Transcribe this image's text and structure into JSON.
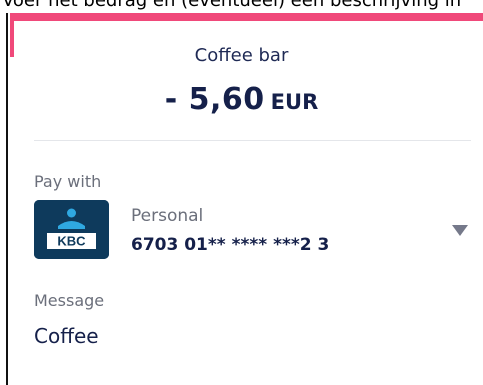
{
  "header": {
    "instruction_text": "Voer het bedrag en (eventueel) een beschrijving in"
  },
  "payment": {
    "payee": "Coffee bar",
    "amount": "- 5,60",
    "currency": "EUR"
  },
  "pay_with": {
    "label": "Pay with",
    "bank_logo_text": "KBC",
    "account_type": "Personal",
    "account_number": "6703 01** **** ***2 3",
    "dropdown_icon": "triangle-down-icon"
  },
  "message": {
    "label": "Message",
    "value": "Coffee"
  },
  "colors": {
    "accent_pink": "#f0497a",
    "navy_text": "#15204a",
    "gray_text": "#6b6f7b",
    "kbc_blue": "#0e3a5c",
    "kbc_light_blue": "#2fa8e1"
  }
}
